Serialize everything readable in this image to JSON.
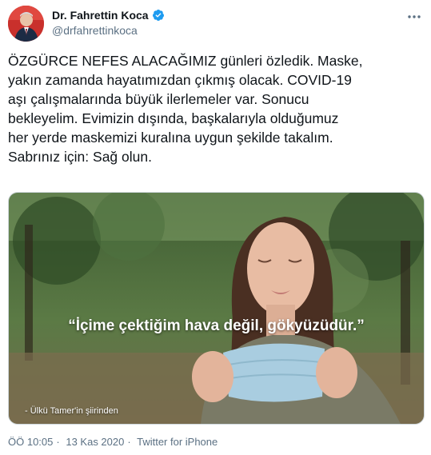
{
  "user": {
    "name": "Dr. Fahrettin Koca",
    "handle": "@drfahrettinkoca"
  },
  "tweet": {
    "text": "ÖZGÜRCE NEFES ALACAĞIMIZ günleri özledik. Maske,\nyakın zamanda hayatımızdan çıkmış olacak. COVID-19\naşı çalışmalarında büyük ilerlemeler var. Sonucu\nbekleyelim. Evimizin dışında, başkalarıyla olduğumuz\nher yerde maskemizi kuralına uygun şekilde takalım.\nSabrınız için: Sağ olun.",
    "media": {
      "quote": "“İçime çektiğim hava değil, gökyüzüdür.”",
      "credit": "- Ülkü Tamer'in şiirinden"
    },
    "time": "ÖÖ 10:05",
    "separator1": "·",
    "date": "13 Kas 2020",
    "separator2": "·",
    "source": "Twitter for iPhone"
  },
  "icons": {
    "verified": "verified-badge-icon",
    "more": "more-options-icon"
  },
  "colors": {
    "accent": "#1d9bf0",
    "secondary_text": "#5b7083"
  }
}
